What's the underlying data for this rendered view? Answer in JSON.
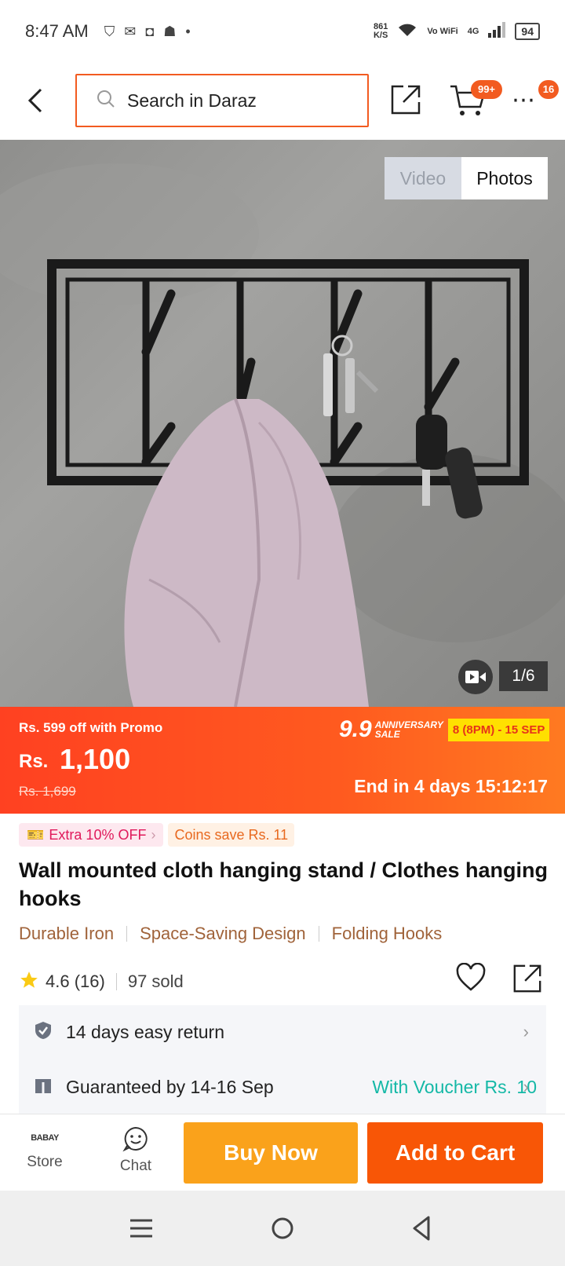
{
  "status_bar": {
    "time": "8:47 AM",
    "notification_icons": [
      "shield-icon",
      "gmail-icon",
      "instagram-icon",
      "snapchat-icon",
      "dot-icon"
    ],
    "net_speed_value": "861",
    "net_speed_unit": "K/S",
    "vowifi": "Vo WiFi",
    "network": "4G",
    "battery": "94"
  },
  "header": {
    "search_placeholder": "Search in Daraz",
    "cart_badge": "99+",
    "more_badge": "16"
  },
  "gallery": {
    "video_label": "Video",
    "photos_label": "Photos",
    "counter": "1/6"
  },
  "price": {
    "promo_text": "Rs. 599 off with Promo",
    "currency": "Rs.",
    "current": "1,100",
    "original": "Rs. 1,699",
    "campaign_number": "9.9",
    "campaign_name_line1": "ANNIVERSARY",
    "campaign_name_line2": "SALE",
    "campaign_dates": "8 (8PM) - 15 SEP",
    "countdown": "End in 4 days 15:12:17"
  },
  "tags": {
    "extra_off": "Extra 10% OFF",
    "coins": "Coins save Rs. 11"
  },
  "product": {
    "title": "Wall mounted cloth hanging stand / Clothes hanging hooks",
    "features": [
      "Durable Iron",
      "Space-Saving Design",
      "Folding Hooks"
    ],
    "rating": "4.6 (16)",
    "sold": "97 sold"
  },
  "services": {
    "return_text": "14 days easy return",
    "delivery_text": "Guaranteed by 14-16 Sep",
    "voucher_text": "With Voucher Rs. 10"
  },
  "bottom_bar": {
    "store_logo": "BABAY",
    "store_label": "Store",
    "chat_label": "Chat",
    "buy_now": "Buy Now",
    "add_to_cart": "Add to Cart"
  },
  "colors": {
    "brand_orange": "#f85606",
    "buy_now_yellow": "#faa21b",
    "voucher_teal": "#14b8a6",
    "feature_brown": "#a0633a"
  }
}
